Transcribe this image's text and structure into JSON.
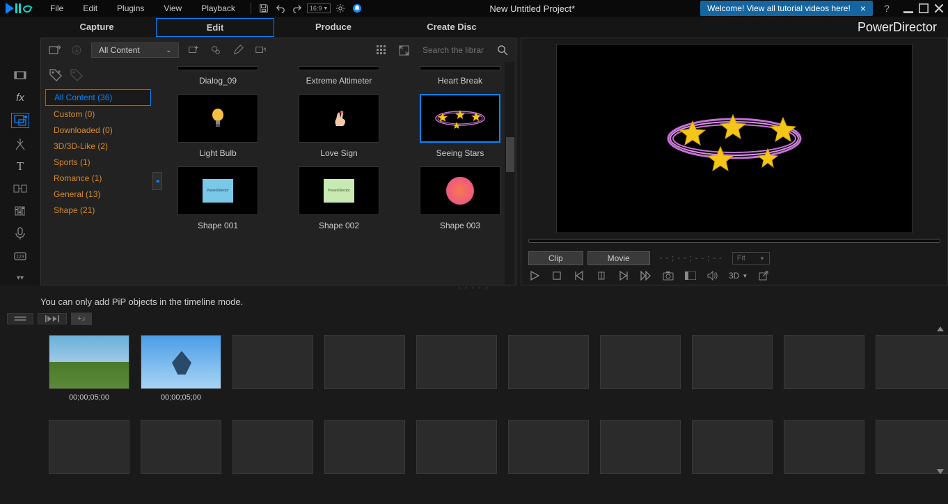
{
  "menu": {
    "items": [
      "File",
      "Edit",
      "Plugins",
      "View",
      "Playback"
    ]
  },
  "ratio": "16:9",
  "project_title": "New Untitled Project*",
  "tutorial_banner": "Welcome! View all tutorial videos here!",
  "brand": "PowerDirector",
  "modes": {
    "items": [
      "Capture",
      "Edit",
      "Produce",
      "Create Disc"
    ],
    "active": 1
  },
  "library": {
    "dropdown": "All Content",
    "search_placeholder": "Search the library",
    "categories": [
      {
        "label": "All Content (36)",
        "active": true
      },
      {
        "label": "Custom  (0)"
      },
      {
        "label": "Downloaded  (0)"
      },
      {
        "label": "3D/3D-Like  (2)"
      },
      {
        "label": "Sports  (1)"
      },
      {
        "label": "Romance  (1)"
      },
      {
        "label": "General  (13)"
      },
      {
        "label": "Shape  (21)"
      }
    ],
    "items_row0": [
      {
        "label": "Dialog_09"
      },
      {
        "label": "Extreme Altimeter"
      },
      {
        "label": "Heart Break"
      }
    ],
    "items_row1": [
      {
        "label": "Light Bulb",
        "kind": "bulb"
      },
      {
        "label": "Love Sign",
        "kind": "hand"
      },
      {
        "label": "Seeing Stars",
        "kind": "stars",
        "selected": true
      }
    ],
    "items_row2": [
      {
        "label": "Shape 001",
        "kind": "shape1"
      },
      {
        "label": "Shape 002",
        "kind": "shape2"
      },
      {
        "label": "Shape 003",
        "kind": "shape3"
      }
    ]
  },
  "preview": {
    "clip_tab": "Clip",
    "movie_tab": "Movie",
    "timecode": "- - ; - - ; - - ; - -",
    "fit": "Fit",
    "threeD": "3D"
  },
  "info_text": "You can only add PiP objects in the timeline mode.",
  "storyboard": {
    "clips": [
      {
        "duration": "00;00;05;00",
        "scene": "scene1"
      },
      {
        "duration": "00;00;05;00",
        "scene": "scene2"
      }
    ],
    "empty_slots_row1": 8,
    "empty_slots_row2": 10
  }
}
